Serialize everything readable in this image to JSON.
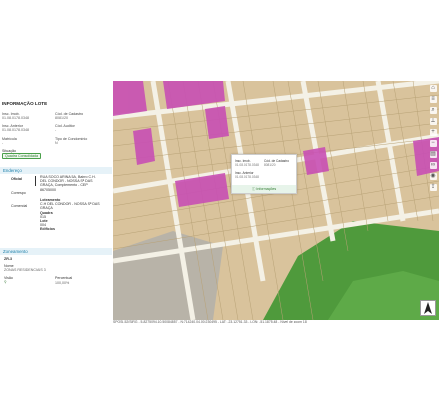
{
  "panel": {
    "title": "INFORMAÇÃO LOTE",
    "fields": {
      "insc_imob_label": "Insc. Imob.",
      "insc_imob_value": "01.08.0178.0348",
      "cad_cartorio_label": "Cód. de Cadastro",
      "cad_cartorio_value": "8081/20",
      "insc_anterior_label": "Insc. Anterior",
      "insc_anterior_value": "01.08.0178.0348",
      "cod_auditor_label": "Cód. Auditor",
      "cod_auditor_value": "-",
      "matricula_label": "Matrícula",
      "matricula_value": "-",
      "tipo_condominio_label": "Tipo de Condomínio",
      "tipo_condominio_value": "N",
      "situacao_label": "Situação",
      "situacao_value": "Quadra Consolidada"
    },
    "endereco": {
      "header": "Endereço",
      "oficial_label": "Oficial",
      "oficial_value": "RUA SOCO ARINA 5A, Bairro C.H. DEL CONDOR - NOSSA Sª DAS GRAÇA, Complemento - CEP 86705000",
      "correspondencia_label": "Correspo",
      "comercial_label": "Comercial",
      "loteamento_label": "Loteamento",
      "loteamento_value": "C.H DEL CONDOR - NOSSA Sª DAS GRAÇA",
      "quadra_label": "Quadra",
      "quadra_value": "015",
      "lote_label": "Lote",
      "lote_value": "004",
      "edificios_label": "Edifícios"
    },
    "zoneamento": {
      "header": "Zoneamento",
      "code": "ZR-3",
      "nome_label": "Nome",
      "nome_value": "ZONAS RESIDENCIAIS 3",
      "visao_label": "Visão",
      "percentual_label": "Percentual",
      "percentual_value": "100,00%"
    }
  },
  "popup": {
    "insc_label": "Insc. Imob.",
    "insc_value": "01.08.0178.0348",
    "cad_label": "Cód. de Cadastro",
    "cad_value": "8081/20",
    "ant_label": "Insc. Anterior",
    "ant_value": "01.08.0178.0348",
    "button": "Informações"
  },
  "toolbar": {
    "icons": [
      "home-icon",
      "layers-icon",
      "search-icon",
      "measure-icon",
      "zoom-in-icon",
      "zoom-out-icon",
      "print-icon",
      "link-icon",
      "camera-icon",
      "share-icon"
    ]
  },
  "statusbar": {
    "text": "SPOSI-52/SIRG - 5-8275094.10.50084857 - N:714240.04.00:230495 - LAT: -23.12751.33 - LON: -51.1875.48 - Nível de zoom 18"
  },
  "colors": {
    "map_blocks": "#e8d2a8",
    "commercial": "#c84fb4",
    "vegetation": "#4f9a3c",
    "roads": "#f3efe3",
    "popup_accent": "#2f7a2f"
  }
}
